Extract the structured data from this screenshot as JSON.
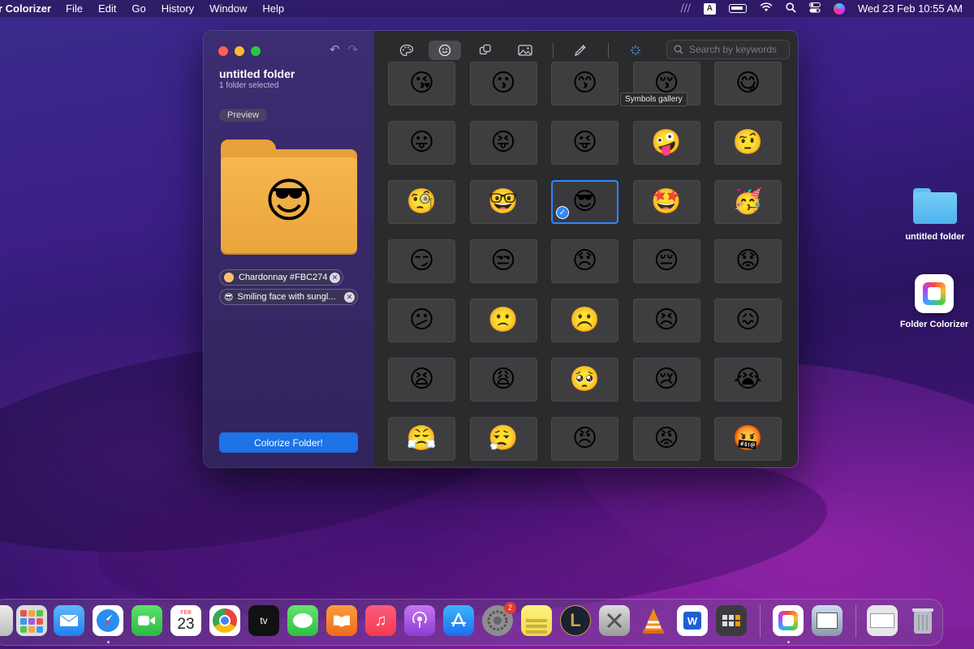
{
  "menubar": {
    "app_name": "r Colorizer",
    "items": [
      "File",
      "Edit",
      "Go",
      "History",
      "Window",
      "Help"
    ],
    "keyboard_indicator": "A",
    "datetime": "Wed 23 Feb  10:55 AM"
  },
  "window": {
    "folder_title": "untitled folder",
    "folder_subtitle": "1 folder selected",
    "preview_label": "Preview",
    "preview_emoji": "😎",
    "tags": [
      {
        "label": "Chardonnay #FBC274",
        "color": "#FBC274"
      },
      {
        "label": "Smiling face with sungl...",
        "icon": "😎"
      }
    ],
    "colorize_button": "Colorize Folder!",
    "search_placeholder": "Search by keywords",
    "tooltip": "Symbols gallery",
    "selected_index": 12,
    "emojis": [
      "😘",
      "😗",
      "😙",
      "😚",
      "😋",
      "😛",
      "😝",
      "😜",
      "🤪",
      "🤨",
      "🧐",
      "🤓",
      "😎",
      "🤩",
      "🥳",
      "😏",
      "😒",
      "😞",
      "😔",
      "😟",
      "😕",
      "🙁",
      "☹️",
      "😣",
      "😖",
      "😫",
      "😩",
      "🥺",
      "😢",
      "😭",
      "😤",
      "😮‍💨",
      "😠",
      "😡",
      "🤬"
    ]
  },
  "desktop": {
    "icons": [
      {
        "label": "untitled folder",
        "icon": "folder-icon"
      },
      {
        "label": "Folder Colorizer",
        "icon": "folder-colorizer-app-icon"
      }
    ]
  },
  "dock": {
    "calendar_month": "FEB",
    "calendar_day": "23",
    "settings_badge": "2",
    "apps": [
      "launchpad",
      "mail",
      "safari",
      "facetime",
      "calendar",
      "chrome",
      "appletv",
      "messages",
      "books",
      "music",
      "podcasts",
      "appstore",
      "system-preferences",
      "stickies",
      "league-of-legends",
      "docker",
      "vlc",
      "word",
      "calculator",
      "folder-colorizer",
      "preview",
      "finder-window",
      "trash"
    ]
  }
}
